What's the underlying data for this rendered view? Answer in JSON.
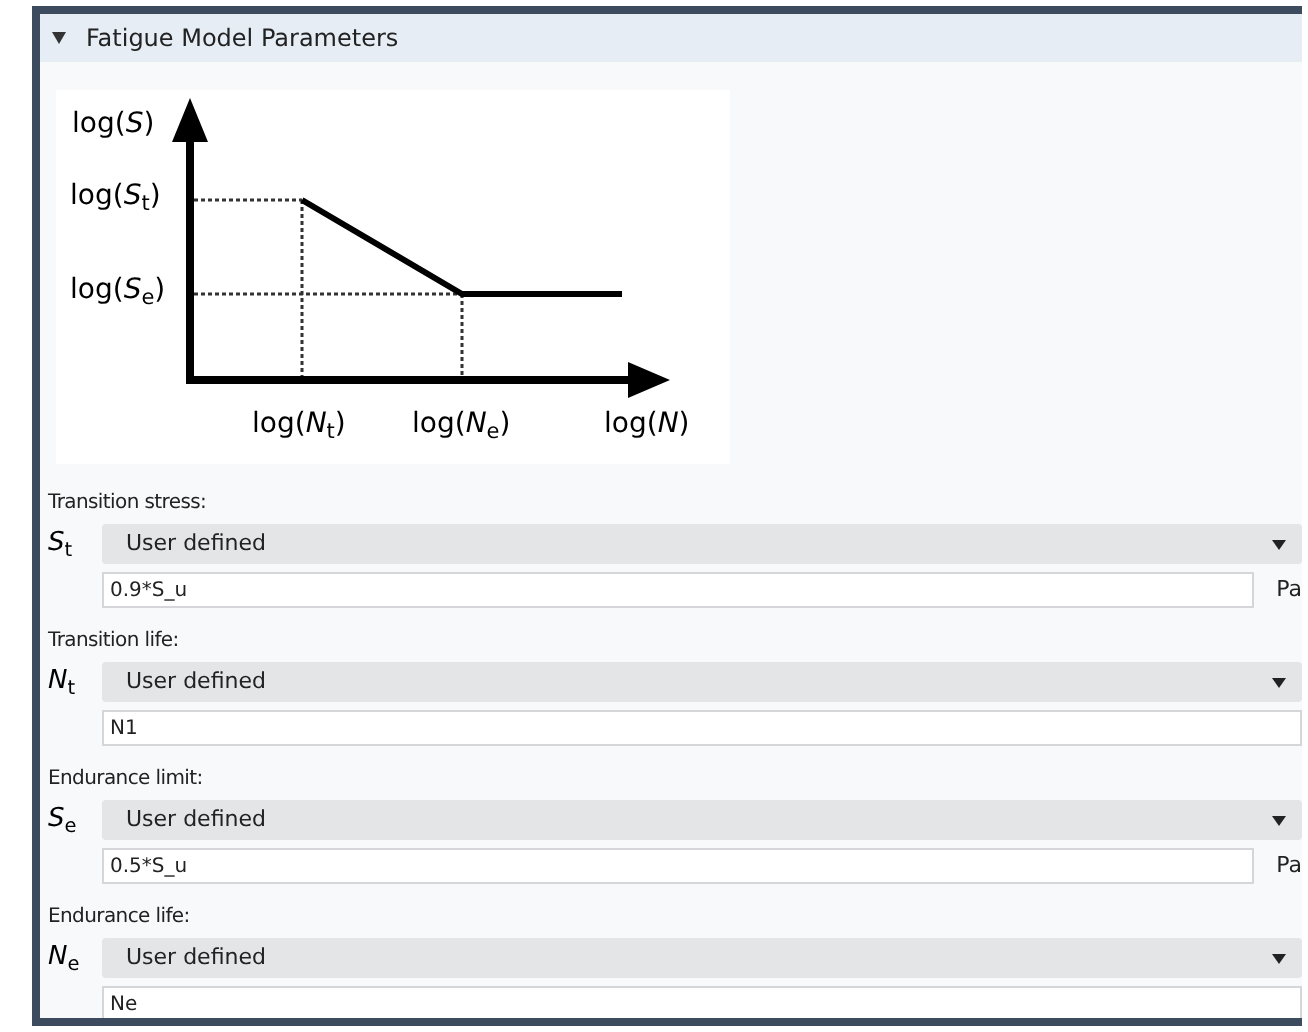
{
  "section": {
    "title": "Fatigue Model Parameters",
    "expanded": true
  },
  "diagram": {
    "y_axis_label": "log(*S*)",
    "y_ticks": [
      "log(*S*$_{t}$)",
      "log(*S*$_{e}$)"
    ],
    "x_ticks": [
      "log(*N*$_{t}$)",
      "log(*N*$_{e}$)"
    ],
    "x_axis_label": "log(*N*)"
  },
  "parameters": [
    {
      "heading": "Transition stress:",
      "symbol": "*S*$_{t}$",
      "option": "User defined",
      "value": "0.9*S_u",
      "unit": "Pa"
    },
    {
      "heading": "Transition life:",
      "symbol": "*N*$_{t}$",
      "option": "User defined",
      "value": "N1"
    },
    {
      "heading": "Endurance limit:",
      "symbol": "*S*$_{e}$",
      "option": "User defined",
      "value": "0.5*S_u",
      "unit": "Pa"
    },
    {
      "heading": "Endurance life:",
      "symbol": "*N*$_{e}$",
      "option": "User defined",
      "value": "Ne"
    }
  ]
}
